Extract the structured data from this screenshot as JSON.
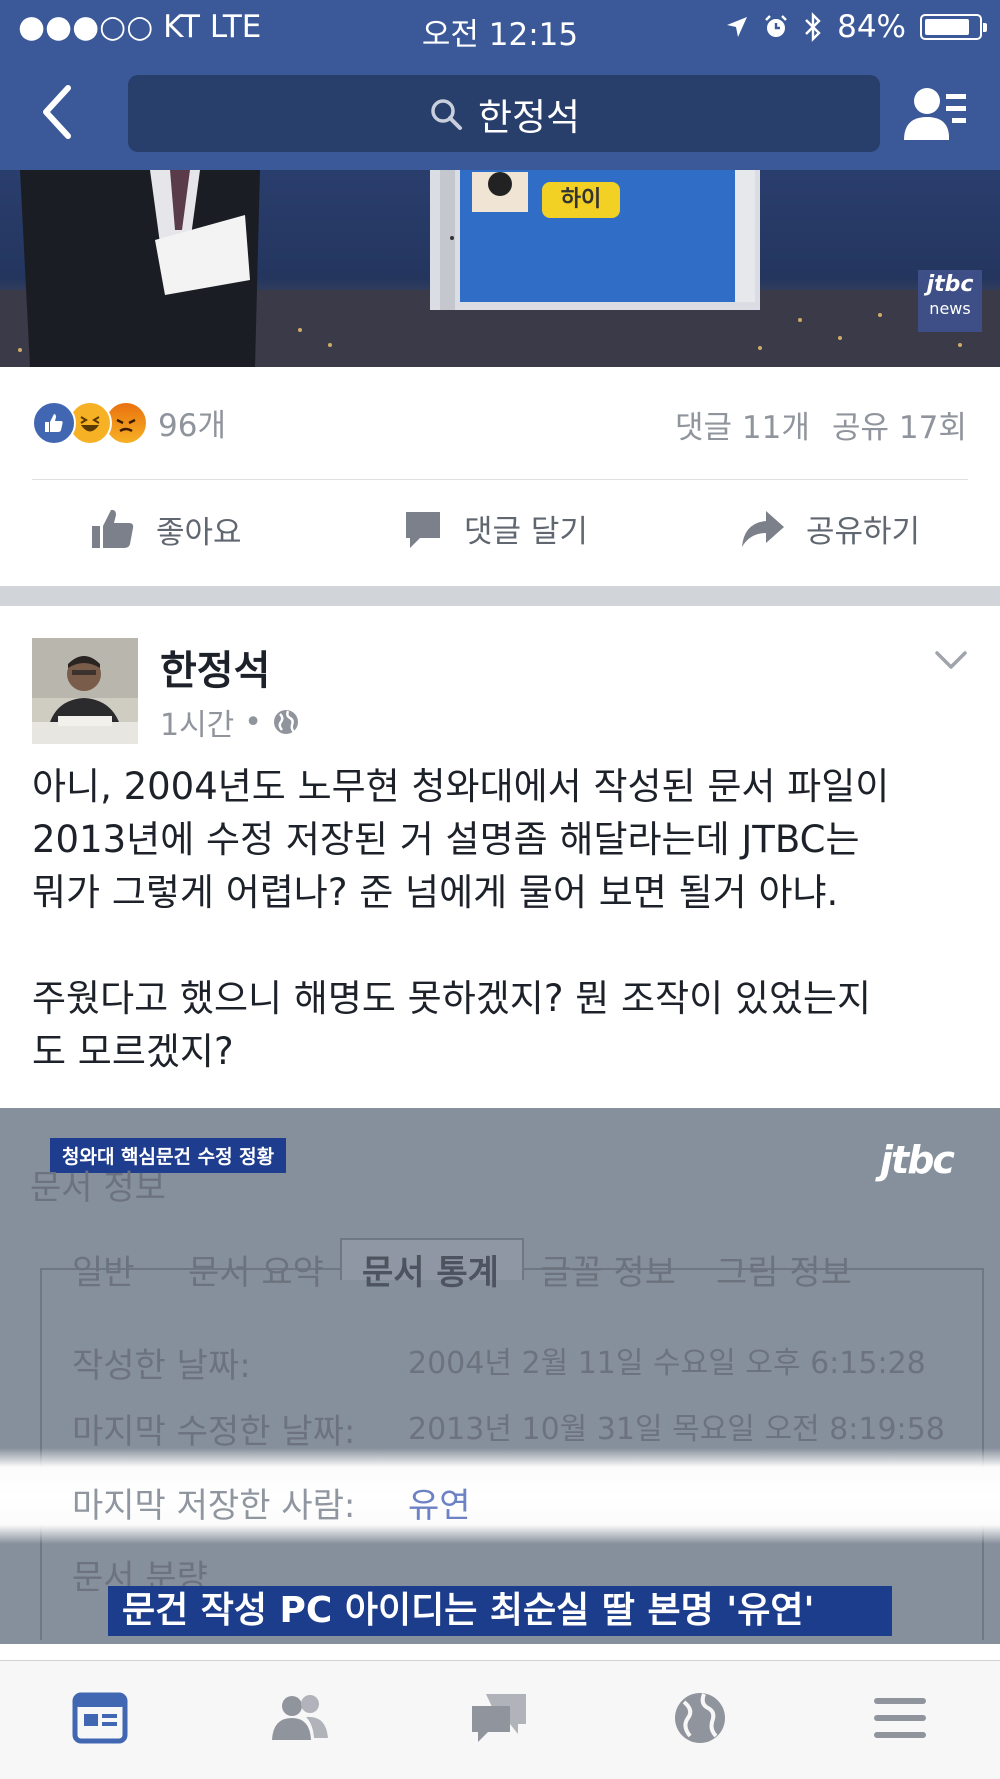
{
  "status_bar": {
    "carrier": "●●●○○ KT   LTE",
    "time": "오전 12:15",
    "battery": "84%",
    "battery_level": 0.84
  },
  "header": {
    "search_text": "한정석"
  },
  "top_video": {
    "chat_bubble": "하이",
    "logo_main": "jtbc",
    "logo_sub": "news"
  },
  "reactions": {
    "count": "96개",
    "comments": "댓글 11개",
    "shares": "공유 17회"
  },
  "actions": {
    "like": "좋아요",
    "comment": "댓글 달기",
    "share": "공유하기"
  },
  "post": {
    "author": "한정석",
    "time": "1시간",
    "dot": "•",
    "paragraph1_lines": [
      "아니, 2004년도 노무현 청와대에서 작성된  문서 파일이",
      "2013년에 수정 저장된 거 설명좀 해달라는데 JTBC는",
      "뭐가 그렇게 어렵나? 준 넘에게 물어 보면 될거 아냐."
    ],
    "paragraph2_lines": [
      "주웠다고 했으니 해명도 못하겠지? 뭔 조작이 있었는지",
      "도 모르겠지?"
    ]
  },
  "news_image": {
    "tag": "청와대 핵심문건 수정 정황",
    "logo": "jtbc",
    "window_title": "문서 정보",
    "tabs": [
      "일반",
      "문서 요약",
      "문서 통계",
      "글꼴 정보",
      "그림 정보"
    ],
    "row1_label": "작성한 날짜:",
    "row1_value": "2004년 2월 11일 수요일 오후 6:15:28",
    "row2_label": "마지막 수정한 날짜:",
    "row2_value": "2013년 10월 31일 목요일 오전 8:19:58",
    "row3_label": "마지막 저장한 사람:",
    "row3_value": "유연",
    "section_label": "문서 분량",
    "caption": "문건 작성 PC 아이디는 최순실 딸 본명 '유연'"
  },
  "colors": {
    "header": "#3b5998",
    "search_bg": "#283e6b",
    "accent_blue": "#4267b2",
    "muted_text": "#90949c"
  },
  "tab_bar": {
    "icons": [
      "news-feed-icon",
      "friends-icon",
      "messages-icon",
      "notifications-globe-icon",
      "menu-icon"
    ]
  }
}
